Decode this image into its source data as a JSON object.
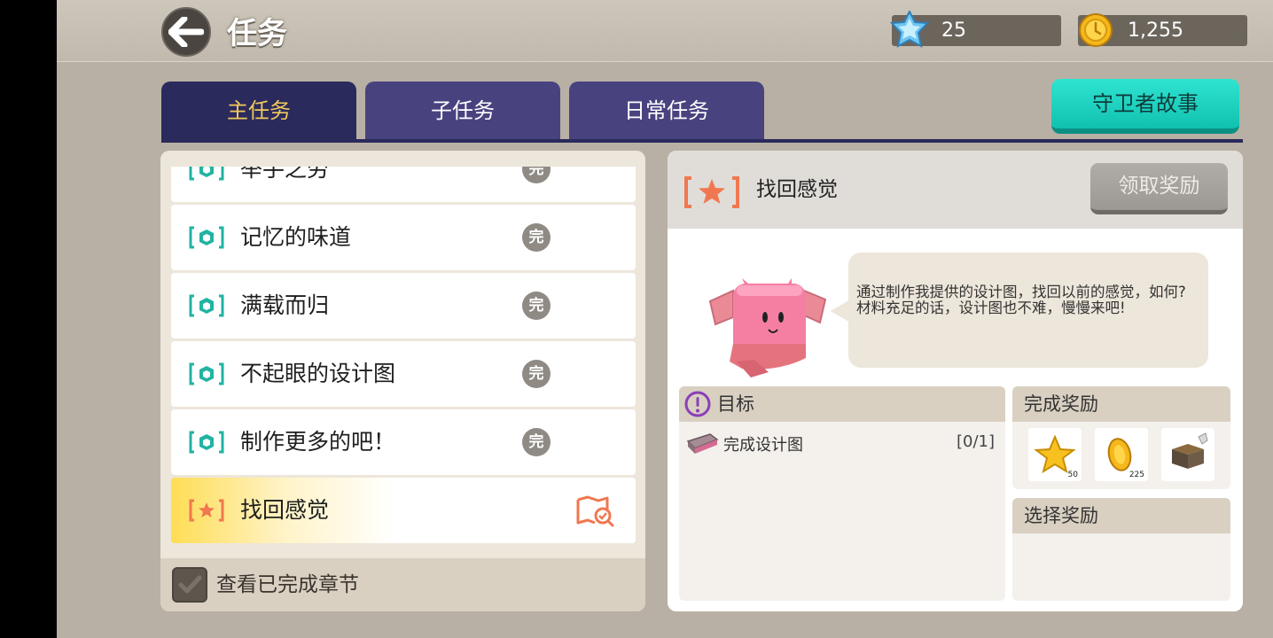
{
  "header": {
    "title": "任务",
    "diamonds": "25",
    "coins": "1,255"
  },
  "tabs": [
    {
      "label": "主任务",
      "active": true
    },
    {
      "label": "子任务",
      "active": false
    },
    {
      "label": "日常任务",
      "active": false
    }
  ],
  "story_button": "守卫者故事",
  "quests": [
    {
      "label": "举手之劳",
      "status": "完"
    },
    {
      "label": "记忆的味道",
      "status": "完"
    },
    {
      "label": "满载而归",
      "status": "完"
    },
    {
      "label": "不起眼的设计图",
      "status": "完"
    },
    {
      "label": "制作更多的吧！",
      "status": "完"
    },
    {
      "label": "找回感觉",
      "status": "current"
    }
  ],
  "footer": {
    "show_completed_label": "查看已完成章节"
  },
  "detail": {
    "title": "找回感觉",
    "claim_button": "领取奖励",
    "dialog_line1": "通过制作我提供的设计图，找回以前的感觉，如何?",
    "dialog_line2": "材料充足的话，设计图也不难，慢慢来吧!",
    "goal_title": "目标",
    "goal_item": "完成设计图",
    "goal_progress": "[0/1]",
    "reward_title": "完成奖励",
    "reward_counts": [
      "50",
      "225",
      ""
    ],
    "select_title": "选择奖励"
  },
  "colors": {
    "active_tab": "#2a2a5c",
    "inactive_tab": "#48437f",
    "story_button": "#11c1b0",
    "main_quest_icon": "#f07850",
    "completed_quest_icon": "#21b3a3"
  }
}
